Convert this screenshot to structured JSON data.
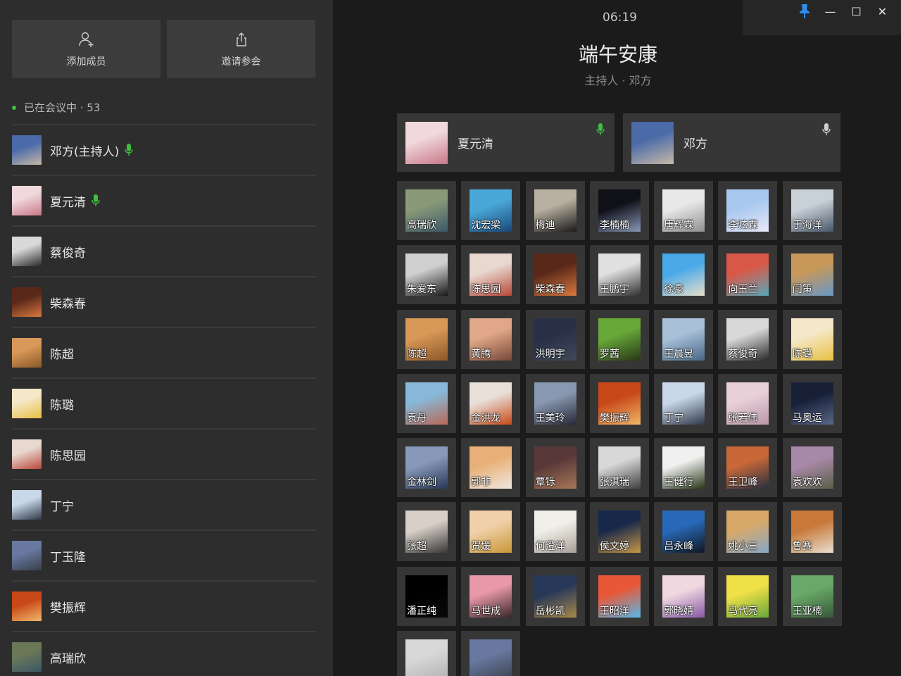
{
  "left": {
    "add_member_label": "添加成员",
    "invite_label": "邀请参会",
    "meeting_count": "已在会议中 · 53",
    "members": [
      {
        "name": "邓方(主持人)",
        "mic": true,
        "c1": "#4a6aa8",
        "c2": "#c8b8a8"
      },
      {
        "name": "夏元清",
        "mic": true,
        "c1": "#f0d8dc",
        "c2": "#c87888"
      },
      {
        "name": "蔡俊奇",
        "mic": false,
        "c1": "#d8d8d8",
        "c2": "#2a2a2a"
      },
      {
        "name": "柴森春",
        "mic": false,
        "c1": "#5a2818",
        "c2": "#d87840"
      },
      {
        "name": "陈超",
        "mic": false,
        "c1": "#d89858",
        "c2": "#8a5828"
      },
      {
        "name": "陈璐",
        "mic": false,
        "c1": "#f4e8c8",
        "c2": "#e8c040"
      },
      {
        "name": "陈思园",
        "mic": false,
        "c1": "#e8d8d0",
        "c2": "#b84838"
      },
      {
        "name": "丁宁",
        "mic": false,
        "c1": "#c8d8e8",
        "c2": "#303848"
      },
      {
        "name": "丁玉隆",
        "mic": false,
        "c1": "#6878a0",
        "c2": "#38404a"
      },
      {
        "name": "樊振辉",
        "mic": false,
        "c1": "#c84818",
        "c2": "#f0b868"
      },
      {
        "name": "高瑞欣",
        "mic": false,
        "c1": "#6a7858",
        "c2": "#3a5868"
      }
    ]
  },
  "header": {
    "time": "06:19",
    "title": "端午安康",
    "host": "主持人 · 邓方"
  },
  "window": {
    "pin": "pin-icon",
    "minimize": "—",
    "maximize": "☐",
    "close": "✕"
  },
  "speakers": [
    {
      "name": "夏元清",
      "mic_active": true,
      "mic_color": "#3fbf3f",
      "c1": "#f0d8dc",
      "c2": "#c87888"
    },
    {
      "name": "邓方",
      "mic_active": false,
      "mic_color": "#cfcfcf",
      "c1": "#4a6aa8",
      "c2": "#c8b8a8"
    }
  ],
  "tiles": [
    {
      "name": "高瑞欣",
      "c1": "#8a9a78",
      "c2": "#3a5868"
    },
    {
      "name": "沈宏梁",
      "c1": "#4aa8d8",
      "c2": "#1a4878"
    },
    {
      "name": "梅迪",
      "c1": "#b8b0a0",
      "c2": "#1a1a1a"
    },
    {
      "name": "李楠楠",
      "c1": "#101018",
      "c2": "#8898b8"
    },
    {
      "name": "唐辉霖",
      "c1": "#e8e8e8",
      "c2": "#909090"
    },
    {
      "name": "李炫霖",
      "c1": "#a8c8f0",
      "c2": "#e8e8f8"
    },
    {
      "name": "于海洋",
      "c1": "#c8d0d8",
      "c2": "#485868"
    },
    {
      "name": "朱爱东",
      "c1": "#d0d0d0",
      "c2": "#181818"
    },
    {
      "name": "陈思园",
      "c1": "#e8d8d0",
      "c2": "#b84838"
    },
    {
      "name": "柴森春",
      "c1": "#5a2818",
      "c2": "#d87840"
    },
    {
      "name": "王鹏宇",
      "c1": "#e0e0e0",
      "c2": "#303030"
    },
    {
      "name": "徐豪",
      "c1": "#48a8e8",
      "c2": "#e8e0c8"
    },
    {
      "name": "向玉兰",
      "c1": "#d85848",
      "c2": "#58a8b8"
    },
    {
      "name": "闫策",
      "c1": "#c89858",
      "c2": "#6898c8"
    },
    {
      "name": "陈超",
      "c1": "#d89858",
      "c2": "#8a5828"
    },
    {
      "name": "黄腾",
      "c1": "#e0a888",
      "c2": "#784838"
    },
    {
      "name": "洪明宇",
      "c1": "#283048",
      "c2": "#404858"
    },
    {
      "name": "罗茜",
      "c1": "#68a838",
      "c2": "#283818"
    },
    {
      "name": "王晨昱",
      "c1": "#a8c0d8",
      "c2": "#486888"
    },
    {
      "name": "蔡俊奇",
      "c1": "#d8d8d8",
      "c2": "#2a2a2a"
    },
    {
      "name": "陈璐",
      "c1": "#f4e8c8",
      "c2": "#e8c040"
    },
    {
      "name": "袁丹",
      "c1": "#88b8d8",
      "c2": "#b86858"
    },
    {
      "name": "金洪龙",
      "c1": "#e8e0d8",
      "c2": "#c84818"
    },
    {
      "name": "王美玲",
      "c1": "#8898b0",
      "c2": "#282838"
    },
    {
      "name": "樊振辉",
      "c1": "#c84818",
      "c2": "#f0b868"
    },
    {
      "name": "丁宁",
      "c1": "#c8d8e8",
      "c2": "#303848"
    },
    {
      "name": "张若伟",
      "c1": "#e8d0d8",
      "c2": "#b898a8"
    },
    {
      "name": "马奥运",
      "c1": "#182038",
      "c2": "#586888"
    },
    {
      "name": "金林剑",
      "c1": "#8898b8",
      "c2": "#283858"
    },
    {
      "name": "郭非",
      "c1": "#e8b078",
      "c2": "#f0e8e0"
    },
    {
      "name": "覃铄",
      "c1": "#583838",
      "c2": "#a87858"
    },
    {
      "name": "张淇瑞",
      "c1": "#d8d8d8",
      "c2": "#404040"
    },
    {
      "name": "王健行",
      "c1": "#f0f0f0",
      "c2": "#283818"
    },
    {
      "name": "王卫峰",
      "c1": "#c86838",
      "c2": "#283040"
    },
    {
      "name": "袁欢欢",
      "c1": "#a888a8",
      "c2": "#586048"
    },
    {
      "name": "张超",
      "c1": "#d8d0c8",
      "c2": "#383838"
    },
    {
      "name": "贺媛",
      "c1": "#f0d0a8",
      "c2": "#c89838"
    },
    {
      "name": "何澄洋",
      "c1": "#f0f0e8",
      "c2": "#a8a098"
    },
    {
      "name": "侯文婷",
      "c1": "#182848",
      "c2": "#c89848"
    },
    {
      "name": "吕永峰",
      "c1": "#2868b8",
      "c2": "#101820"
    },
    {
      "name": "姚小三",
      "c1": "#d8a868",
      "c2": "#88a8c8"
    },
    {
      "name": "鲁赛",
      "c1": "#c87838",
      "c2": "#e8e0d0"
    },
    {
      "name": "潘正纯",
      "c1": "#000000",
      "c2": "#080808"
    },
    {
      "name": "马世成",
      "c1": "#e898a8",
      "c2": "#382828"
    },
    {
      "name": "岳彬凯",
      "c1": "#283858",
      "c2": "#a88848"
    },
    {
      "name": "王昭洋",
      "c1": "#e85838",
      "c2": "#58b8e8"
    },
    {
      "name": "郭晓婧",
      "c1": "#f0d8e0",
      "c2": "#8858a8"
    },
    {
      "name": "马代亮",
      "c1": "#f0e048",
      "c2": "#68a838"
    },
    {
      "name": "王亚楠",
      "c1": "#68a868",
      "c2": "#385838"
    },
    {
      "name": "",
      "c1": "#d8d8d8",
      "c2": "#b0b0b0"
    },
    {
      "name": "",
      "c1": "#6878a0",
      "c2": "#38404a"
    }
  ]
}
